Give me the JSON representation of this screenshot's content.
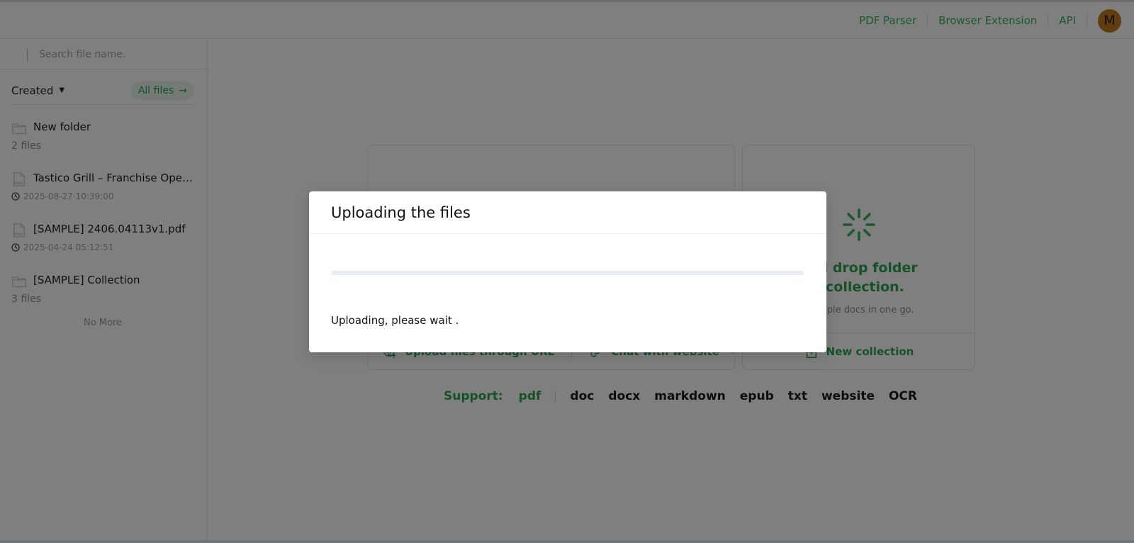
{
  "topnav": {
    "items": [
      "PDF Parser",
      "Browser Extension",
      "API"
    ],
    "avatar_initial": "M"
  },
  "sidebar": {
    "search_placeholder": "Search file name.",
    "sort_label": "Created",
    "all_files_label": "All files",
    "items": [
      {
        "type": "folder",
        "name": "New folder",
        "meta": "2 files"
      },
      {
        "type": "pdf",
        "name": "Tastico Grill – Franchise Operations Manual.pdf",
        "meta": "2025-08-27 10:39:00"
      },
      {
        "type": "pdf",
        "name": "[SAMPLE] 2406.04113v1.pdf",
        "meta": "2025-04-24 05:12:51"
      },
      {
        "type": "folder",
        "name": "[SAMPLE] Collection",
        "meta": "3 files"
      }
    ],
    "no_more": "No More"
  },
  "main": {
    "upload_url_label": "Upload files through URL",
    "chat_website_label": "Chat with website",
    "drop_title_line1": "and drop folder",
    "drop_title_line2": "s collection.",
    "drop_subtitle": "multiple docs in one go.",
    "new_collection_label": "New collection",
    "support_label": "Support:",
    "support_pdf": "pdf",
    "support_types": [
      "doc",
      "docx",
      "markdown",
      "epub",
      "txt",
      "website",
      "OCR"
    ]
  },
  "modal": {
    "title": "Uploading the files",
    "status": "Uploading, please wait .",
    "progress": 0
  },
  "colors": {
    "accent": "#35b35a",
    "overlay": "rgba(0,0,0,0.5)"
  }
}
